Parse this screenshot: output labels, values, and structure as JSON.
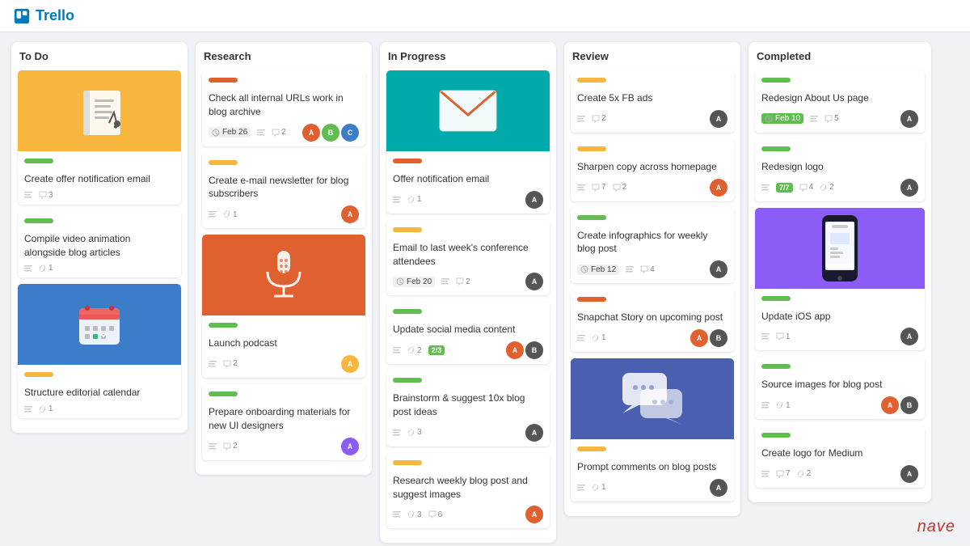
{
  "app": {
    "name": "Trello"
  },
  "columns": [
    {
      "id": "todo",
      "title": "To Do",
      "cards": [
        {
          "id": "todo-1",
          "hasImage": true,
          "imageType": "notebook",
          "imageBg": "#f6b73c",
          "label": "green",
          "title": "Create offer notification email",
          "meta": {
            "desc": true,
            "attachments": null,
            "comments": "3",
            "date": null
          },
          "avatars": []
        },
        {
          "id": "todo-2",
          "hasImage": false,
          "label": "green",
          "title": "Compile video animation alongside blog articles",
          "meta": {
            "desc": true,
            "attachments": "1",
            "comments": null,
            "date": null
          },
          "avatars": []
        },
        {
          "id": "todo-3",
          "hasImage": true,
          "imageType": "calendar",
          "imageBg": "#3b7dc8",
          "label": "yellow",
          "title": "Structure editorial calendar",
          "meta": {
            "desc": true,
            "attachments": "1",
            "comments": null,
            "date": null
          },
          "avatars": []
        }
      ]
    },
    {
      "id": "research",
      "title": "Research",
      "cards": [
        {
          "id": "res-1",
          "hasImage": false,
          "label": "orange",
          "title": "Check all internal URLs work in blog archive",
          "meta": {
            "desc": true,
            "attachments": null,
            "comments": "2",
            "date": "Feb 26",
            "dateBg": ""
          },
          "avatars": [
            "#e06030",
            "#61bd4f",
            "#3b7dc8"
          ]
        },
        {
          "id": "res-2",
          "hasImage": false,
          "label": "yellow",
          "title": "Create e-mail newsletter for blog subscribers",
          "meta": {
            "desc": true,
            "attachments": "1",
            "comments": null,
            "date": null
          },
          "avatars": [
            "#e06030"
          ]
        },
        {
          "id": "res-3",
          "hasImage": true,
          "imageType": "mic",
          "imageBg": "#e06030",
          "label": "green",
          "title": "Launch podcast",
          "meta": {
            "desc": true,
            "attachments": null,
            "comments": "2",
            "date": null
          },
          "avatars": [
            "#f6b73c"
          ]
        },
        {
          "id": "res-4",
          "hasImage": false,
          "label": "green",
          "title": "Prepare onboarding materials for new UI designers",
          "meta": {
            "desc": true,
            "attachments": null,
            "comments": "2",
            "date": null
          },
          "avatars": [
            "#8b5cf6"
          ]
        }
      ]
    },
    {
      "id": "inprogress",
      "title": "In Progress",
      "cards": [
        {
          "id": "ip-1",
          "hasImage": true,
          "imageType": "envelope",
          "imageBg": "#00aaaa",
          "label": "orange",
          "title": "Offer notification email",
          "meta": {
            "desc": true,
            "attachments": "1",
            "comments": null,
            "date": null
          },
          "avatars": [
            "#555"
          ]
        },
        {
          "id": "ip-2",
          "hasImage": false,
          "label": "yellow",
          "title": "Email to last week's conference attendees",
          "meta": {
            "desc": true,
            "attachments": null,
            "comments": "2",
            "date": "Feb 20",
            "dateBg": ""
          },
          "avatars": [
            "#555"
          ]
        },
        {
          "id": "ip-3",
          "hasImage": false,
          "label": "green",
          "title": "Update social media content",
          "meta": {
            "desc": true,
            "attachments": "2",
            "comments": null,
            "date": null,
            "progress": "2/3"
          },
          "avatars": [
            "#e06030",
            "#555"
          ]
        },
        {
          "id": "ip-4",
          "hasImage": false,
          "label": "green",
          "title": "Brainstorm & suggest 10x blog post ideas",
          "meta": {
            "desc": true,
            "attachments": "3",
            "comments": null,
            "date": null
          },
          "avatars": [
            "#555"
          ]
        },
        {
          "id": "ip-5",
          "hasImage": false,
          "label": "yellow",
          "title": "Research weekly blog post and suggest images",
          "meta": {
            "desc": true,
            "attachments": "3",
            "comments": "6",
            "date": null
          },
          "avatars": [
            "#e06030"
          ]
        }
      ]
    },
    {
      "id": "review",
      "title": "Review",
      "cards": [
        {
          "id": "rev-1",
          "hasImage": false,
          "label": "yellow",
          "title": "Create 5x FB ads",
          "meta": {
            "desc": true,
            "attachments": null,
            "comments": "2",
            "date": null
          },
          "avatars": [
            "#555"
          ]
        },
        {
          "id": "rev-2",
          "hasImage": false,
          "label": "yellow",
          "title": "Sharpen copy across homepage",
          "meta": {
            "desc": true,
            "attachments": null,
            "comments": "2",
            "date": null,
            "extra": "7"
          },
          "avatars": [
            "#e06030"
          ]
        },
        {
          "id": "rev-3",
          "hasImage": false,
          "label": "green",
          "title": "Create infographics for weekly blog post",
          "meta": {
            "desc": true,
            "attachments": null,
            "comments": "4",
            "date": "Feb 12",
            "dateBg": ""
          },
          "avatars": [
            "#555"
          ]
        },
        {
          "id": "rev-4",
          "hasImage": false,
          "label": "orange",
          "title": "Snapchat Story on upcoming post",
          "meta": {
            "desc": true,
            "attachments": "1",
            "comments": null,
            "date": null
          },
          "avatars": [
            "#e06030",
            "#555"
          ]
        },
        {
          "id": "rev-5",
          "hasImage": true,
          "imageType": "chat",
          "imageBg": "#4b5fb0",
          "label": "yellow",
          "title": "Prompt comments on blog posts",
          "meta": {
            "desc": true,
            "attachments": "1",
            "comments": null,
            "date": null
          },
          "avatars": [
            "#555"
          ]
        }
      ]
    },
    {
      "id": "completed",
      "title": "Completed",
      "cards": [
        {
          "id": "comp-1",
          "hasImage": false,
          "label": "green",
          "title": "Redesign About Us page",
          "meta": {
            "desc": true,
            "attachments": null,
            "comments": "5",
            "date": "Feb 10",
            "dateBg": "green"
          },
          "avatars": [
            "#555"
          ]
        },
        {
          "id": "comp-2",
          "hasImage": false,
          "label": "green",
          "title": "Redesign logo",
          "meta": {
            "desc": true,
            "attachments": null,
            "comments": "4",
            "date": null,
            "extra2": "2",
            "progress2": "7/7"
          },
          "avatars": [
            "#555"
          ]
        },
        {
          "id": "comp-3",
          "hasImage": true,
          "imageType": "phone",
          "imageBg": "#8b5cf6",
          "label": "green",
          "title": "Update iOS app",
          "meta": {
            "desc": true,
            "attachments": null,
            "comments": "1",
            "date": null
          },
          "avatars": [
            "#555"
          ]
        },
        {
          "id": "comp-4",
          "hasImage": false,
          "label": "green",
          "title": "Source images for blog post",
          "meta": {
            "desc": true,
            "attachments": "1",
            "comments": null,
            "date": null
          },
          "avatars": [
            "#e06030",
            "#555"
          ]
        },
        {
          "id": "comp-5",
          "hasImage": false,
          "label": "green",
          "title": "Create logo for Medium",
          "meta": {
            "desc": true,
            "attachments": null,
            "comments": "7",
            "date": null,
            "extra3": "2"
          },
          "avatars": [
            "#555"
          ]
        }
      ]
    }
  ],
  "nave": "nave"
}
